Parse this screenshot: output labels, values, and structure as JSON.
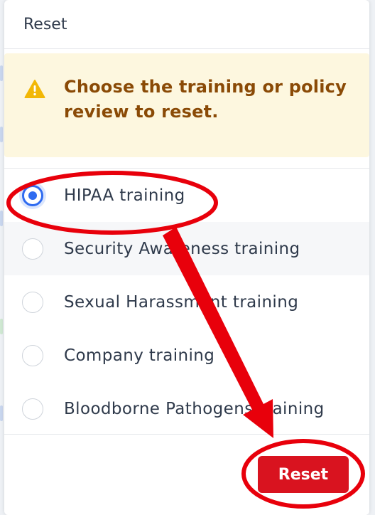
{
  "dialog": {
    "title": "Reset"
  },
  "alert": {
    "icon": "warning-icon",
    "message": "Choose the training or policy review to reset.",
    "background_color": "#fdf7df",
    "text_color": "#8a4a06"
  },
  "options": [
    {
      "label": "HIPAA training",
      "selected": true
    },
    {
      "label": "Security Awareness training",
      "selected": false
    },
    {
      "label": "Sexual Harassment training",
      "selected": false
    },
    {
      "label": "Company training",
      "selected": false
    },
    {
      "label": "Bloodborne Pathogens training",
      "selected": false
    }
  ],
  "footer": {
    "reset_label": "Reset",
    "reset_color": "#d9131f"
  },
  "annotation": {
    "color": "#e8000b"
  }
}
